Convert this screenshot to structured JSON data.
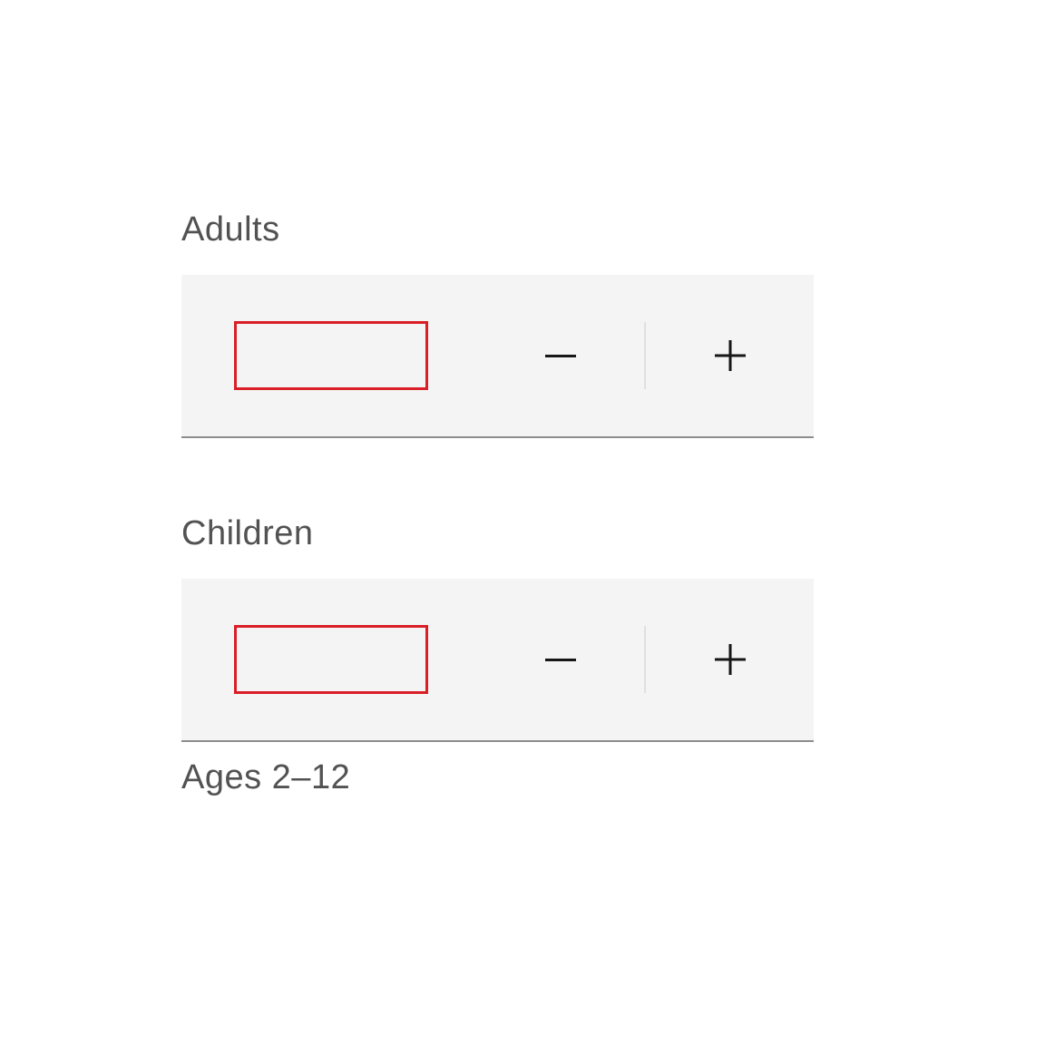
{
  "steppers": {
    "adults": {
      "label": "Adults",
      "value": "",
      "helper": ""
    },
    "children": {
      "label": "Children",
      "value": "",
      "helper": "Ages 2–12"
    }
  }
}
